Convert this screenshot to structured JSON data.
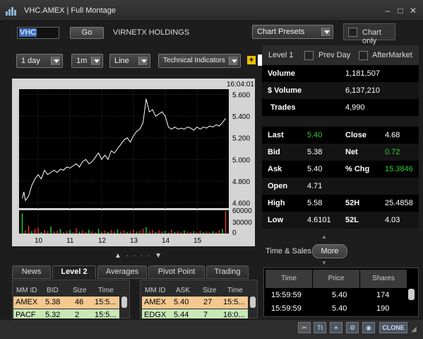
{
  "window": {
    "title": "VHC.AMEX | Full Montage",
    "controls": [
      "–",
      "□",
      "✕"
    ]
  },
  "toolbar": {
    "symbol_value": "VHC",
    "go_label": "Go",
    "company_name": "VIRNETX HOLDINGS",
    "chart_presets_label": "Chart Presets",
    "chart_only_label": "Chart only",
    "period_value": "1 day",
    "interval_value": "1m",
    "chart_style_value": "Line",
    "technical_indicators_label": "Technical Indicators",
    "add_icon_label": "+"
  },
  "level1": {
    "title": "Level 1",
    "prev_day_label": "Prev Day",
    "after_market_label": "AfterMarket",
    "volume_label": "Volume",
    "volume_value": "1,181,507",
    "dollar_volume_label": "$ Volume",
    "dollar_volume_value": "6,137,210",
    "trades_label": "Trades",
    "trades_value": "4,990",
    "last_label": "Last",
    "last_value": "5.40",
    "close_label": "Close",
    "close_value": "4.68",
    "bid_label": "Bid",
    "bid_value": "5.38",
    "net_label": "Net",
    "net_value": "0.72",
    "ask_label": "Ask",
    "ask_value": "5.40",
    "pct_chg_label": "% Chg",
    "pct_chg_value": "15.3846",
    "open_label": "Open",
    "open_value": "4.71",
    "high_label": "High",
    "high_value": "5.58",
    "h52_label": "52H",
    "h52_value": "25.4858",
    "low_label": "Low",
    "low_value": "4.6101",
    "l52_label": "52L",
    "l52_value": "4.03"
  },
  "time_sales": {
    "title": "Time & Sales",
    "more_label": "More",
    "headers": [
      "Time",
      "Price",
      "Shares"
    ],
    "rows": [
      [
        "15:59:59",
        "5.40",
        "174"
      ],
      [
        "15:59:59",
        "5.40",
        "190"
      ]
    ]
  },
  "tabs": [
    "News",
    "Level 2",
    "Averages",
    "Pivot Point",
    "Trading"
  ],
  "level2": {
    "bid_headers": [
      "MM ID",
      "BID",
      "Size",
      "Time"
    ],
    "bid_rows": [
      [
        "AMEX",
        "5.38",
        "46",
        "15:5..."
      ],
      [
        "PACF",
        "5.32",
        "2",
        "15:5..."
      ]
    ],
    "ask_headers": [
      "MM ID",
      "ASK",
      "Size",
      "Time"
    ],
    "ask_rows": [
      [
        "AMEX",
        "5.40",
        "27",
        "15:5..."
      ],
      [
        "EDGX",
        "5.44",
        "7",
        "16:0..."
      ]
    ]
  },
  "bottom_toolbar": {
    "clone_label": "CLONE",
    "icon_text_label": "Tt"
  },
  "chart_data": {
    "type": "line",
    "last_time_label": "16:04:01",
    "x_ticks": [
      "10",
      "11",
      "12",
      "13",
      "14",
      "15"
    ],
    "y_ticks": [
      "5.600",
      "5.400",
      "5.200",
      "5.000",
      "4.800",
      "4.600"
    ],
    "ylim": [
      4.55,
      5.65
    ],
    "volume_ticks": [
      "60000",
      "30000",
      "0"
    ],
    "volume_ylim": [
      0,
      60000
    ],
    "line_color": "#ffffff",
    "background_color": "#000000",
    "price_series": [
      [
        9.5,
        4.64
      ],
      [
        9.55,
        4.7
      ],
      [
        9.6,
        4.62
      ],
      [
        9.7,
        4.66
      ],
      [
        9.8,
        4.76
      ],
      [
        9.9,
        4.82
      ],
      [
        10.0,
        4.86
      ],
      [
        10.1,
        4.82
      ],
      [
        10.2,
        4.9
      ],
      [
        10.3,
        4.86
      ],
      [
        10.4,
        4.88
      ],
      [
        10.5,
        4.9
      ],
      [
        10.6,
        4.88
      ],
      [
        10.7,
        4.91
      ],
      [
        10.8,
        4.9
      ],
      [
        10.9,
        4.93
      ],
      [
        11.0,
        4.92
      ],
      [
        11.1,
        4.94
      ],
      [
        11.2,
        4.96
      ],
      [
        11.3,
        4.93
      ],
      [
        11.4,
        4.98
      ],
      [
        11.5,
        5.0
      ],
      [
        11.6,
        4.96
      ],
      [
        11.7,
        4.98
      ],
      [
        11.8,
        5.02
      ],
      [
        11.9,
        5.06
      ],
      [
        12.0,
        5.0
      ],
      [
        12.1,
        5.04
      ],
      [
        12.2,
        5.0
      ],
      [
        12.3,
        5.08
      ],
      [
        12.4,
        5.06
      ],
      [
        12.5,
        5.1
      ],
      [
        12.6,
        5.14
      ],
      [
        12.7,
        5.18
      ],
      [
        12.8,
        5.2
      ],
      [
        12.9,
        5.16
      ],
      [
        13.0,
        5.22
      ],
      [
        13.1,
        5.26
      ],
      [
        13.2,
        5.28
      ],
      [
        13.3,
        5.34
      ],
      [
        13.4,
        5.56
      ],
      [
        13.5,
        5.44
      ],
      [
        13.6,
        5.46
      ],
      [
        13.7,
        5.4
      ],
      [
        13.8,
        5.42
      ],
      [
        13.9,
        5.44
      ],
      [
        14.0,
        5.4
      ],
      [
        14.1,
        5.3
      ],
      [
        14.2,
        5.28
      ],
      [
        14.3,
        5.3
      ],
      [
        14.4,
        5.28
      ],
      [
        14.5,
        5.29
      ],
      [
        14.6,
        5.28
      ],
      [
        14.7,
        5.3
      ],
      [
        14.8,
        5.29
      ],
      [
        14.9,
        5.27
      ],
      [
        15.0,
        5.3
      ],
      [
        15.1,
        5.28
      ],
      [
        15.2,
        5.3
      ],
      [
        15.3,
        5.29
      ],
      [
        15.4,
        5.31
      ],
      [
        15.5,
        5.3
      ],
      [
        15.6,
        5.32
      ],
      [
        15.7,
        5.31
      ],
      [
        15.8,
        5.34
      ],
      [
        15.9,
        5.38
      ]
    ],
    "volume_series": [
      [
        9.5,
        52000
      ],
      [
        9.6,
        8000
      ],
      [
        9.7,
        20000
      ],
      [
        9.8,
        6000
      ],
      [
        9.9,
        12000
      ],
      [
        10.0,
        15000
      ],
      [
        10.1,
        4000
      ],
      [
        10.2,
        9000
      ],
      [
        10.3,
        6000
      ],
      [
        10.4,
        18000
      ],
      [
        10.5,
        5000
      ],
      [
        10.6,
        7000
      ],
      [
        10.7,
        11000
      ],
      [
        10.8,
        4000
      ],
      [
        10.9,
        6000
      ],
      [
        11.0,
        9000
      ],
      [
        11.1,
        3000
      ],
      [
        11.2,
        14000
      ],
      [
        11.3,
        5000
      ],
      [
        11.4,
        8000
      ],
      [
        11.5,
        4000
      ],
      [
        11.6,
        10000
      ],
      [
        11.7,
        6000
      ],
      [
        11.8,
        3000
      ],
      [
        11.9,
        12000
      ],
      [
        12.0,
        5000
      ],
      [
        12.1,
        7000
      ],
      [
        12.2,
        4000
      ],
      [
        12.3,
        9000
      ],
      [
        12.4,
        6000
      ],
      [
        12.5,
        11000
      ],
      [
        12.6,
        5000
      ],
      [
        12.7,
        8000
      ],
      [
        12.8,
        4000
      ],
      [
        12.9,
        6000
      ],
      [
        13.0,
        10000
      ],
      [
        13.1,
        5000
      ],
      [
        13.2,
        7000
      ],
      [
        13.3,
        12000
      ],
      [
        13.4,
        16000
      ],
      [
        13.5,
        6000
      ],
      [
        13.6,
        9000
      ],
      [
        13.7,
        4000
      ],
      [
        13.8,
        8000
      ],
      [
        13.9,
        5000
      ],
      [
        14.0,
        7000
      ],
      [
        14.1,
        3000
      ],
      [
        14.2,
        10000
      ],
      [
        14.3,
        4000
      ],
      [
        14.4,
        6000
      ],
      [
        14.5,
        3000
      ],
      [
        14.6,
        8000
      ],
      [
        14.7,
        5000
      ],
      [
        14.8,
        4000
      ],
      [
        14.9,
        6000
      ],
      [
        15.0,
        3000
      ],
      [
        15.1,
        7000
      ],
      [
        15.2,
        4000
      ],
      [
        15.3,
        5000
      ],
      [
        15.4,
        3000
      ],
      [
        15.5,
        6000
      ],
      [
        15.6,
        4000
      ],
      [
        15.7,
        9000
      ],
      [
        15.8,
        12000
      ],
      [
        15.9,
        58000
      ]
    ]
  }
}
